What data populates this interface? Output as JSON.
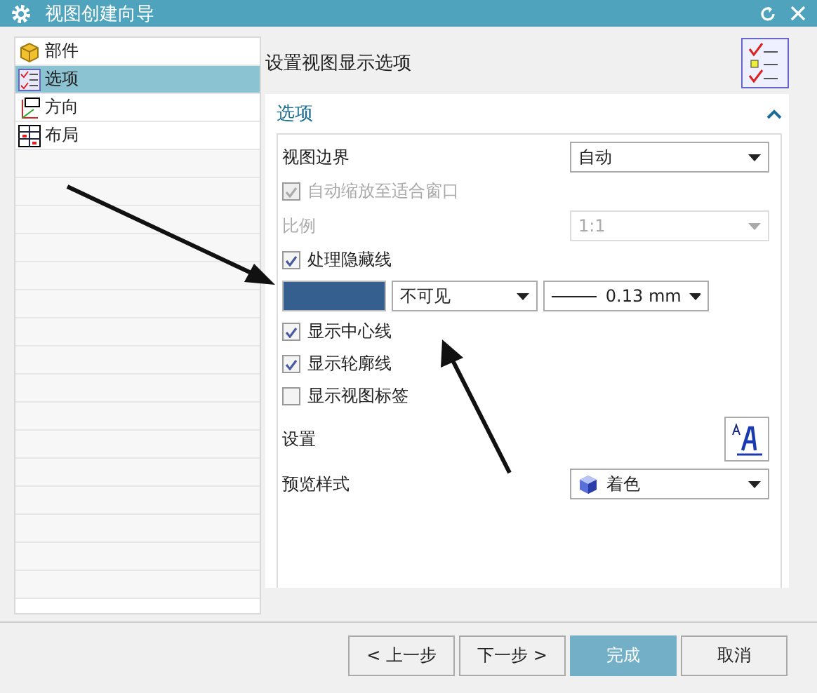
{
  "window": {
    "title": "视图创建向导"
  },
  "sidebar": {
    "items": [
      {
        "label": "部件",
        "selected": false
      },
      {
        "label": "选项",
        "selected": true
      },
      {
        "label": "方向",
        "selected": false
      },
      {
        "label": "布局",
        "selected": false
      }
    ]
  },
  "header": {
    "text": "设置视图显示选项"
  },
  "section": {
    "title": "选项",
    "expanded": true,
    "rows": [
      {
        "kind": "dropdown",
        "label": "视图边界",
        "value": "自动",
        "disabled": false
      },
      {
        "kind": "checkbox",
        "label": "自动缩放至适合窗口",
        "checked": true,
        "disabled": true
      },
      {
        "kind": "dropdown",
        "label": "比例",
        "value": "1:1",
        "disabled": true
      },
      {
        "kind": "checkbox",
        "label": "处理隐藏线",
        "checked": true,
        "disabled": false
      },
      {
        "kind": "lineStyle",
        "color": "#355f8f",
        "font": "不可见",
        "width": "0.13 mm"
      },
      {
        "kind": "checkbox",
        "label": "显示中心线",
        "checked": true,
        "disabled": false
      },
      {
        "kind": "checkbox",
        "label": "显示轮廓线",
        "checked": true,
        "disabled": false
      },
      {
        "kind": "checkbox",
        "label": "显示视图标签",
        "checked": false,
        "disabled": false
      },
      {
        "kind": "iconButton",
        "label": "设置"
      },
      {
        "kind": "dropdown",
        "label": "预览样式",
        "value": "着色",
        "disabled": false
      }
    ]
  },
  "buttons": [
    {
      "label": "< 上一步",
      "selected": false
    },
    {
      "label": "下一步 >",
      "selected": false
    },
    {
      "label": "完成",
      "selected": true
    },
    {
      "label": "取消",
      "selected": false
    }
  ]
}
